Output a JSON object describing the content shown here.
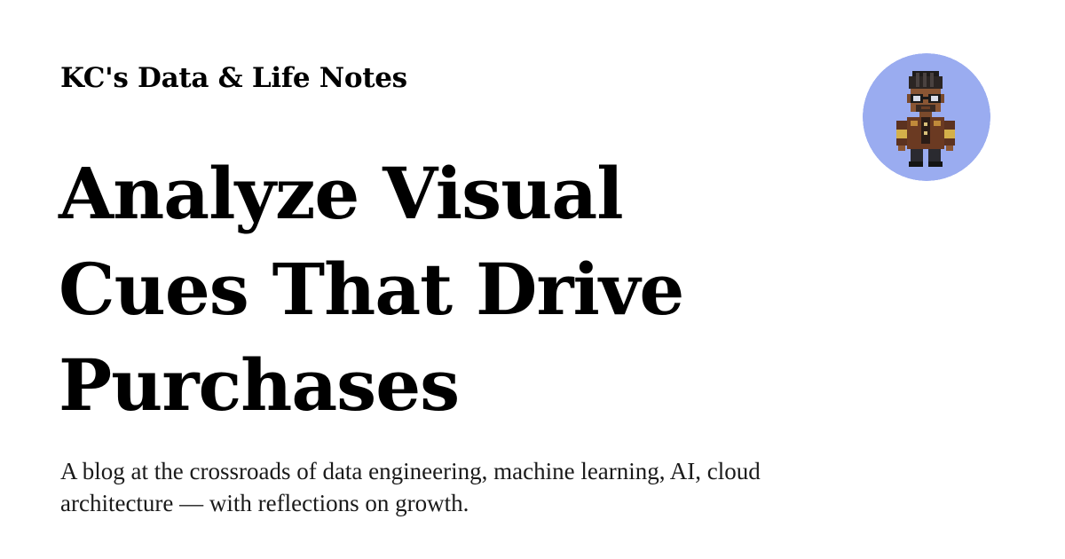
{
  "site": {
    "name": "KC's Data & Life Notes"
  },
  "post": {
    "title": "Analyze Visual Cues That Drive Purchases"
  },
  "blog": {
    "tagline": "A blog at the crossroads of data engineering, machine learning, AI, cloud architecture — with reflections on growth."
  },
  "avatar": {
    "icon": "pixel-art-person-avatar",
    "background_color": "#9aacf0"
  }
}
